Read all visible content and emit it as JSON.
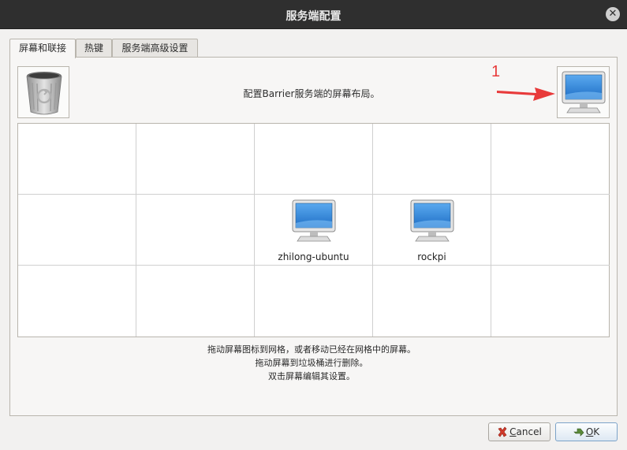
{
  "window": {
    "title": "服务端配置",
    "close_glyph": "✕"
  },
  "tabs": [
    {
      "label": "屏幕和联接",
      "active": true
    },
    {
      "label": "热键",
      "active": false
    },
    {
      "label": "服务端高级设置",
      "active": false
    }
  ],
  "intro_text": "配置Barrier服务端的屏幕布局。",
  "annotation": {
    "number": "1",
    "color": "#e83a3a"
  },
  "grid": {
    "rows": 3,
    "cols": 5,
    "screens": [
      {
        "row": 1,
        "col": 2,
        "name": "zhilong-ubuntu"
      },
      {
        "row": 1,
        "col": 3,
        "name": "rockpi"
      }
    ]
  },
  "help_lines": [
    "拖动屏幕图标到网格，或者移动已经在网格中的屏幕。",
    "拖动屏幕到垃圾桶进行删除。",
    "双击屏幕编辑其设置。"
  ],
  "buttons": {
    "cancel": {
      "mnemonic": "C",
      "rest": "ancel"
    },
    "ok": {
      "mnemonic": "O",
      "rest": "K"
    }
  },
  "icons": {
    "trash": "trash-can-icon",
    "new_screen": "monitor-icon",
    "cancel": "red-x-icon",
    "ok": "green-check-icon"
  },
  "colors": {
    "titlebar": "#2f2f2f",
    "panel": "#f7f6f5",
    "grid_bg": "#ffffff",
    "monitor_screen": "#3a8ee0"
  }
}
